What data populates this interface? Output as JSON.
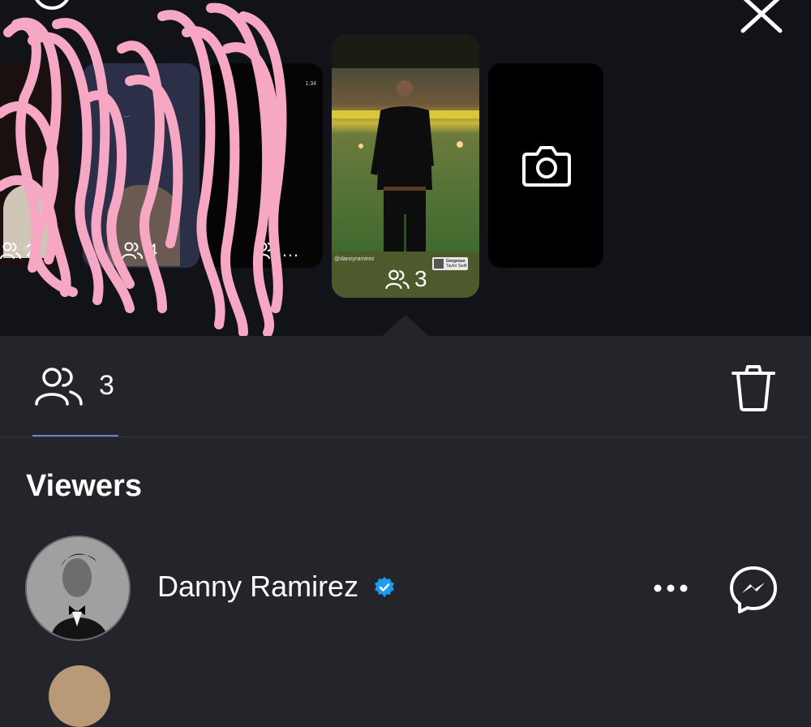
{
  "story_tray": {
    "thumbnails": [
      {
        "id": "story-1",
        "view_count": "2",
        "caption": "…ed"
      },
      {
        "id": "story-2",
        "view_count": "4",
        "caption": "…"
      },
      {
        "id": "story-3",
        "view_count": "…",
        "caption": "1:34"
      },
      {
        "id": "story-4-active",
        "view_count": "3",
        "handle": "@dannyramirez",
        "song_title": "Gorgeous",
        "song_artist": "Taylor Swift"
      }
    ]
  },
  "stats": {
    "viewers_count": "3"
  },
  "viewers": {
    "heading": "Viewers",
    "list": [
      {
        "name": "Danny Ramirez",
        "verified": true
      }
    ]
  },
  "icons": {
    "settings": "settings-icon",
    "close": "close-icon",
    "camera": "camera-icon",
    "viewers": "people-icon",
    "trash": "trash-icon",
    "more": "more-horizontal-icon",
    "messenger": "messenger-icon",
    "verified": "verified-badge-icon"
  },
  "colors": {
    "background": "#23252b",
    "tray_background": "#111318",
    "tab_underline": "#6f7fd8",
    "verified_blue": "#1d9bf0",
    "scribble_pink": "#f5a7c3"
  }
}
